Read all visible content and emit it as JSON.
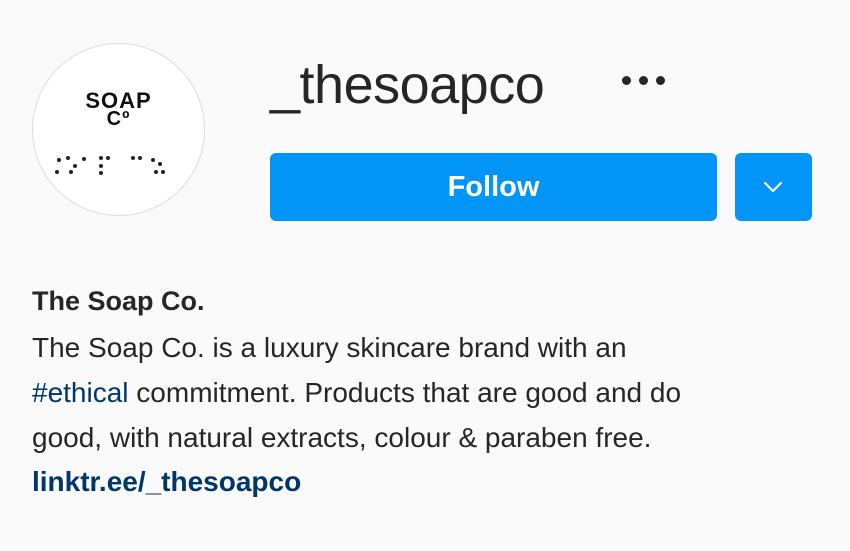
{
  "profile": {
    "username": "_thesoapco",
    "avatar": {
      "logo_line1": "SOAP",
      "logo_line2": "Cº"
    },
    "more_icon": "more-horizontal-icon",
    "follow_label": "Follow",
    "dropdown_icon": "chevron-down-icon"
  },
  "bio": {
    "name": "The Soap Co.",
    "line1": "The Soap Co. is a luxury skincare brand with an",
    "hashtag": "#ethical",
    "line2_rest": " commitment. Products that are good and do",
    "line3": "good, with natural extracts, colour & paraben free.",
    "link": "linktr.ee/_thesoapco"
  },
  "colors": {
    "background": "#fafafa",
    "follow_button": "#0095f6",
    "link": "#00376b",
    "text": "#262626"
  }
}
